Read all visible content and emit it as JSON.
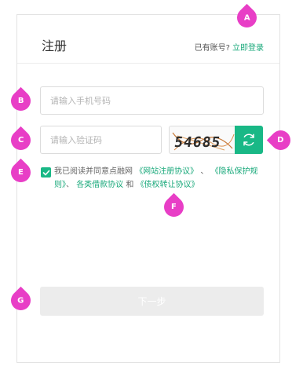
{
  "header": {
    "title": "注册",
    "login_prompt": "已有账号?",
    "login_link": "立即登录"
  },
  "form": {
    "phone_placeholder": "请输入手机号码",
    "code_placeholder": "请输入验证码",
    "captcha_text": "54685",
    "agreement": {
      "prefix": "我已阅读并同意点融网",
      "site_agreement": "《网站注册协议》",
      "sep1": "、",
      "privacy_rules": "《隐私保护规则》",
      "sep2": "、",
      "loan_agreement": "各类借款协议",
      "and": "和",
      "transfer_agreement": "《债权转让协议》",
      "checked": true
    },
    "next_label": "下一步"
  },
  "markers": {
    "a": "A",
    "b": "B",
    "c": "C",
    "d": "D",
    "e": "E",
    "f": "F",
    "g": "G"
  },
  "colors": {
    "accent": "#19b886",
    "marker": "#e83ec6",
    "disabled_button": "#ececec"
  },
  "icons": {
    "refresh": "refresh-icon",
    "check": "check-icon"
  }
}
